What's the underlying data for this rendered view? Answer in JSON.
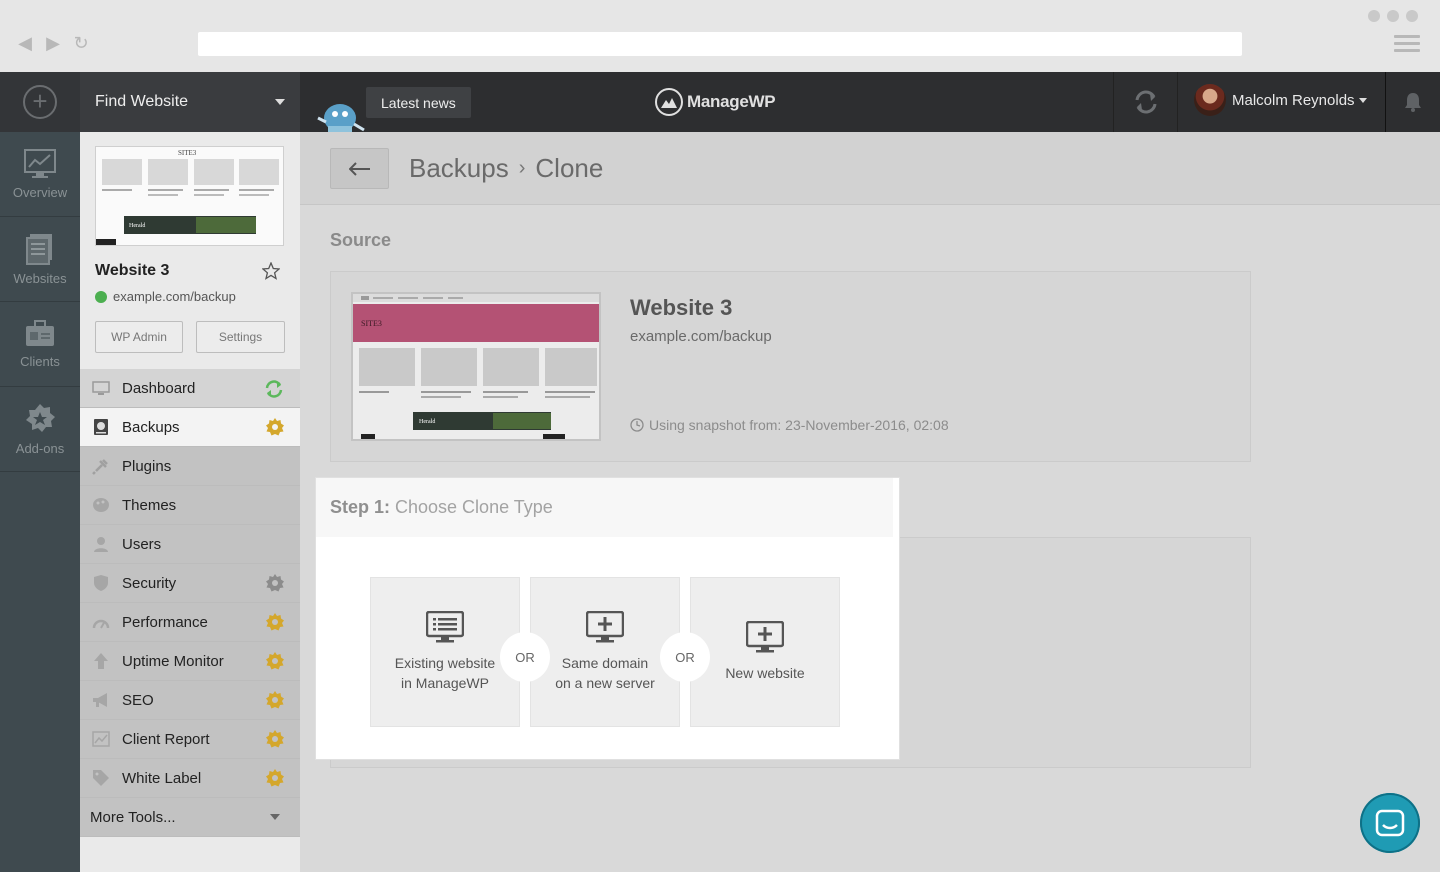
{
  "app": {
    "find_website": "Find Website",
    "latest_news": "Latest news",
    "logo_text": "ManageWP",
    "user_name": "Malcolm Reynolds"
  },
  "rail": {
    "items": [
      {
        "label": "Overview",
        "icon": "chart-icon"
      },
      {
        "label": "Websites",
        "icon": "websites-icon"
      },
      {
        "label": "Clients",
        "icon": "clients-icon"
      },
      {
        "label": "Add-ons",
        "icon": "addons-icon"
      }
    ]
  },
  "site": {
    "title": "Website 3",
    "url": "example.com/backup",
    "wp_admin": "WP Admin",
    "settings": "Settings",
    "thumb_site_name": "SITE3",
    "thumb_banner": "Herald"
  },
  "menu": [
    {
      "label": "Dashboard",
      "icon": "monitor-icon",
      "badge": "sync"
    },
    {
      "label": "Backups",
      "icon": "backup-icon",
      "badge": "gear"
    },
    {
      "label": "Plugins",
      "icon": "plug-icon",
      "badge": ""
    },
    {
      "label": "Themes",
      "icon": "palette-icon",
      "badge": ""
    },
    {
      "label": "Users",
      "icon": "user-icon",
      "badge": ""
    },
    {
      "label": "Security",
      "icon": "shield-icon",
      "badge": "gear-grey"
    },
    {
      "label": "Performance",
      "icon": "gauge-icon",
      "badge": "gear"
    },
    {
      "label": "Uptime Monitor",
      "icon": "arrow-up-icon",
      "badge": "gear"
    },
    {
      "label": "SEO",
      "icon": "megaphone-icon",
      "badge": "gear"
    },
    {
      "label": "Client Report",
      "icon": "report-icon",
      "badge": "gear"
    },
    {
      "label": "White Label",
      "icon": "tag-icon",
      "badge": "gear"
    }
  ],
  "more_tools": "More Tools...",
  "breadcrumb": {
    "parent": "Backups",
    "separator": "›",
    "current": "Clone"
  },
  "source": {
    "section_title": "Source",
    "title": "Website 3",
    "url": "example.com/backup",
    "snapshot": "Using snapshot from: 23-November-2016, 02:08"
  },
  "step": {
    "label": "Step 1:",
    "title": "Choose Clone Type",
    "or": "OR",
    "options": [
      {
        "line1": "Existing website",
        "line2": "in ManageWP",
        "icon": "list-monitor-icon"
      },
      {
        "line1": "Same domain",
        "line2": "on a new server",
        "icon": "monitor-plus-icon"
      },
      {
        "line1": "New website",
        "line2": "",
        "icon": "monitor-plus-icon"
      }
    ]
  },
  "colors": {
    "accent": "#1f9bb4",
    "gear_badge": "#d4a72c",
    "sync_badge": "#5cb85c",
    "rail": "#3f4a4f",
    "topbar": "#2d2e30"
  }
}
